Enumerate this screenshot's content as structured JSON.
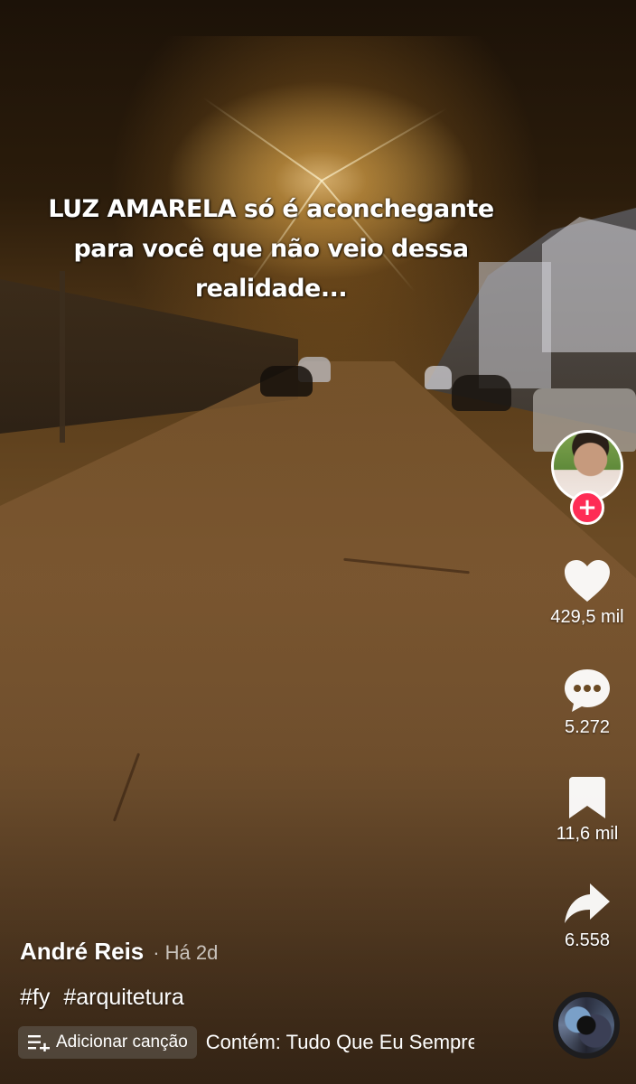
{
  "video": {
    "caption_lines": [
      "LUZ AMARELA só é aconchegante",
      "para você que não veio dessa",
      "realidade..."
    ]
  },
  "actions": {
    "like": {
      "count": "429,5 mil",
      "icon": "heart-icon"
    },
    "comment": {
      "count": "5.272",
      "icon": "comment-icon"
    },
    "save": {
      "count": "11,6 mil",
      "icon": "bookmark-icon"
    },
    "share": {
      "count": "6.558",
      "icon": "share-icon"
    },
    "follow": {
      "symbol": "+"
    }
  },
  "info": {
    "author": "André Reis",
    "separator": "·",
    "time": "Há 2d",
    "hashtags": [
      "#fy",
      "#arquitetura"
    ],
    "add_song_label": "Adicionar canção",
    "contains_text": "Contém: Tudo Que Eu Sempre Sonhei"
  },
  "colors": {
    "follow_accent": "#fe2c55",
    "scene_tone": "#6b4b25"
  }
}
